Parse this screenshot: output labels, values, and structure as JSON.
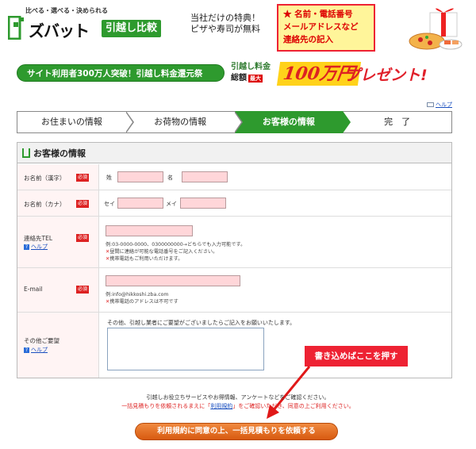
{
  "header": {
    "logo_tag": "比べる・選べる・決められる",
    "logo_name": "ズバット",
    "logo_badge": "引越し比較",
    "tagline": [
      "当社だけの特典！",
      "ピザや寿司が無料"
    ]
  },
  "note_box": [
    "★ 名前・電話番号",
    "メールアドレスなど",
    "連絡先の記入"
  ],
  "banner": {
    "pill": "サイト利用者300万人突破！引越し料金還元祭",
    "mid_line1": "引越し料金",
    "mid_line2": "総額",
    "max_label": "最大",
    "amount": "100万円",
    "present": "プレゼント!"
  },
  "help_link": "ヘルプ",
  "steps": [
    {
      "label": "お住まいの情報",
      "active": false
    },
    {
      "label": "お荷物の情報",
      "active": false
    },
    {
      "label": "お客様の情報",
      "active": true
    },
    {
      "label": "完　了",
      "active": false
    }
  ],
  "form": {
    "title": "お客様の情報",
    "required_label": "必須",
    "name_kanji": {
      "label": "お名前（漢字）",
      "last": "姓",
      "first": "名"
    },
    "name_kana": {
      "label": "お名前（カナ）",
      "last": "セイ",
      "first": "メイ"
    },
    "tel": {
      "label": "連絡先TEL",
      "help": "ヘルプ",
      "example": "例:03-0000-0000、0300000000→どちらでも入力可能です。",
      "notes": [
        "昼間に連絡が可能な電話番号をご記入ください。",
        "携帯電話もご利用いただけます。"
      ]
    },
    "email": {
      "label": "E-mail",
      "example": "例:info@hikkoshi.zba.com",
      "notes": [
        "携帯電話のアドレスは不可です"
      ]
    },
    "other": {
      "label": "その他ご要望",
      "help": "ヘルプ",
      "prompt": "その他、引越し業者にご要望がございましたらご記入をお願いいたします。"
    }
  },
  "bottom": {
    "line1": "引越しお役立ちサービスやお得情報、アンケートなどをご確認ください。",
    "line2_pre": "一括見積もりを依頼されるまえに「",
    "line2_link": "利用規約",
    "line2_post": "」をご確認いただき、同意の上ご利用ください。",
    "submit": "利用規約に同意の上、一括見積もりを依頼する"
  },
  "callout": "書き込めばここを押す",
  "colors": {
    "green": "#2e9a2e",
    "pink_input": "#ffd6d9",
    "red": "#dd2233",
    "orange": "#e06a1a"
  }
}
